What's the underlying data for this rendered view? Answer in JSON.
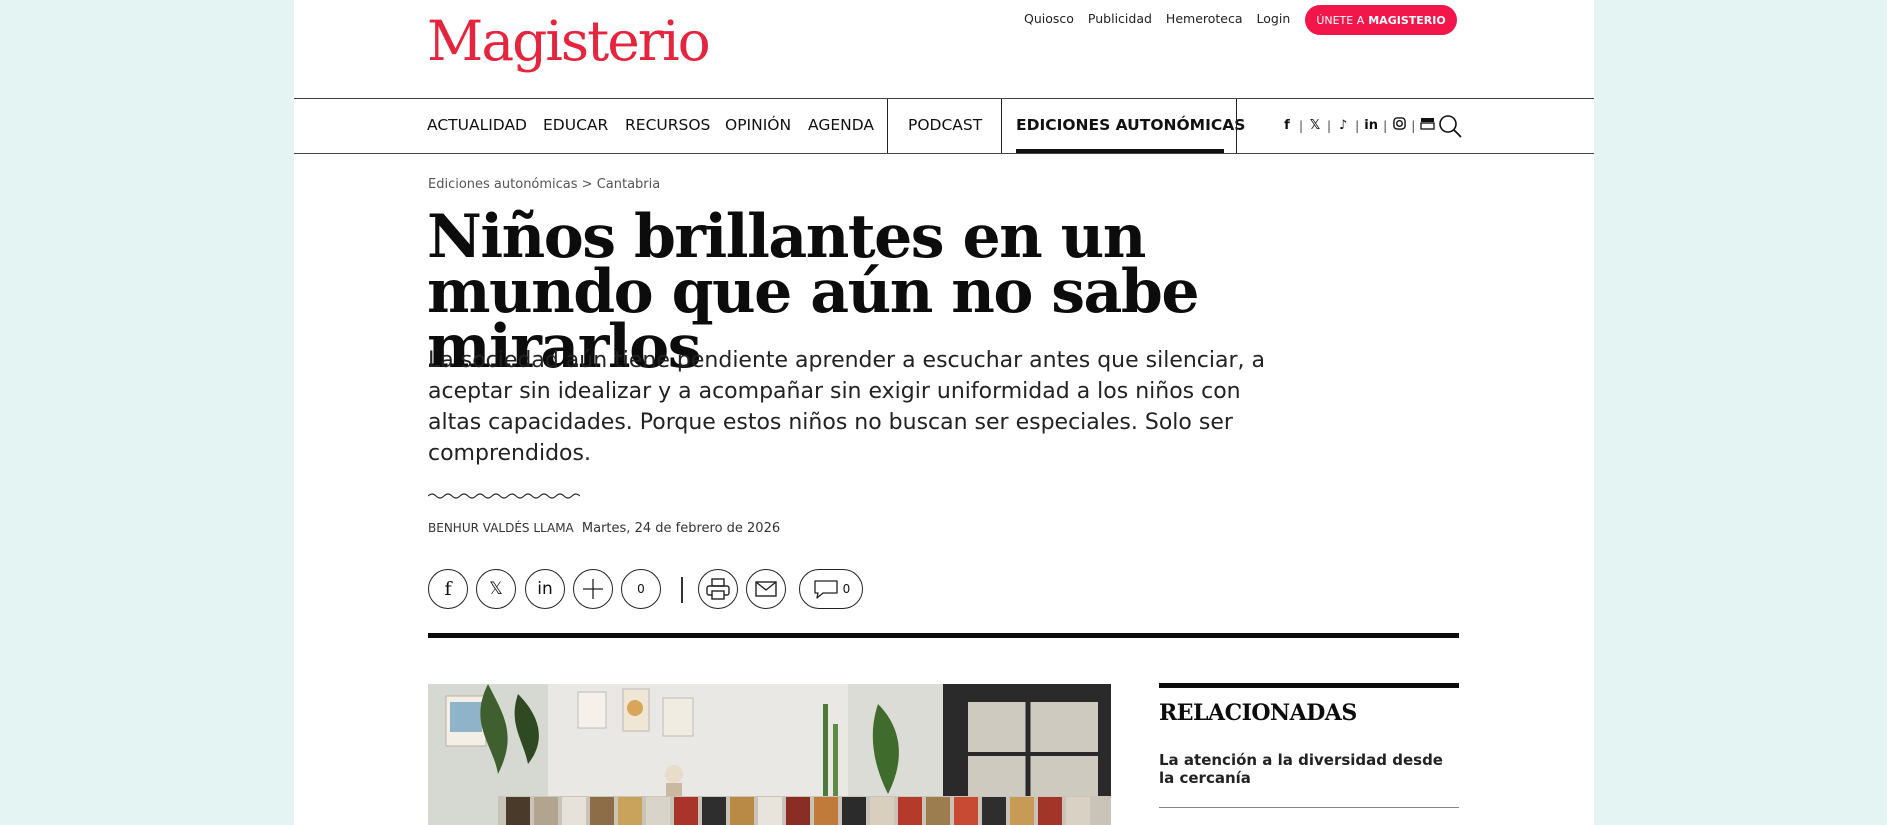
{
  "header": {
    "logo": "Magisterio",
    "top_links": [
      "Quiosco",
      "Publicidad",
      "Hemeroteca",
      "Login"
    ],
    "join_prefix": "ÚNETE A",
    "join_brand": "MAGISTERIO"
  },
  "nav": {
    "items": [
      "ACTUALIDAD",
      "EDUCAR",
      "RECURSOS",
      "OPINIÓN",
      "AGENDA"
    ],
    "podcast": "PODCAST",
    "active": "EDICIONES AUTONÓMICAS",
    "social": [
      "facebook-icon",
      "x-icon",
      "tiktok-icon",
      "linkedin-icon",
      "instagram-icon",
      "youtube-icon"
    ]
  },
  "article": {
    "breadcrumb": "Ediciones autonómicas > Cantabria",
    "title": "Niños brillantes en un mundo que aún no sabe mirarlos",
    "subtitle": "La sociedad aún tiene pendiente aprender a escuchar antes que silenciar, a aceptar sin idealizar y a acompañar sin exigir uniformidad a los niños con altas capacidades. Porque estos niños no buscan ser especiales. Solo ser comprendidos.",
    "author": "BENHUR VALDÉS LLAMA",
    "date": "Martes, 24 de febrero de 2026",
    "share_count": "0",
    "comment_count": "0"
  },
  "aside": {
    "title": "RELACIONADAS",
    "links": [
      "La atención a la diversidad desde la cercanía"
    ]
  },
  "colors": {
    "brand": "#e5253d",
    "join": "#f2164a",
    "outer_bg": "#e4f4f2"
  }
}
